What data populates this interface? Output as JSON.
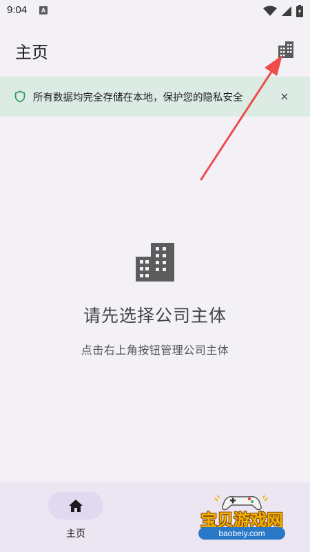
{
  "status_bar": {
    "time": "9:04",
    "notification_icon": "a-icon",
    "wifi_icon": "wifi-icon",
    "battery_icon": "battery-icon"
  },
  "app_bar": {
    "title": "主页",
    "action_icon": "building-icon"
  },
  "privacy_banner": {
    "icon": "shield-icon",
    "text": "所有数据均完全存储在本地，保护您的隐私安全",
    "close_label": "×"
  },
  "empty_state": {
    "icon": "building-icon",
    "title": "请先选择公司主体",
    "subtitle": "点击右上角按钮管理公司主体"
  },
  "bottom_nav": {
    "items": [
      {
        "label": "主页",
        "icon": "home-icon",
        "selected": true
      }
    ]
  },
  "watermark": {
    "text": "宝贝游戏网",
    "url": "baobeiy.com"
  },
  "colors": {
    "banner_bg": "#dcebe3",
    "shield_green": "#2e9e5b",
    "arrow_red": "#ef4b4b",
    "nav_bg": "#ece6f3",
    "nav_pill": "#e0d9ef",
    "page_bg": "#f3f1f6"
  }
}
